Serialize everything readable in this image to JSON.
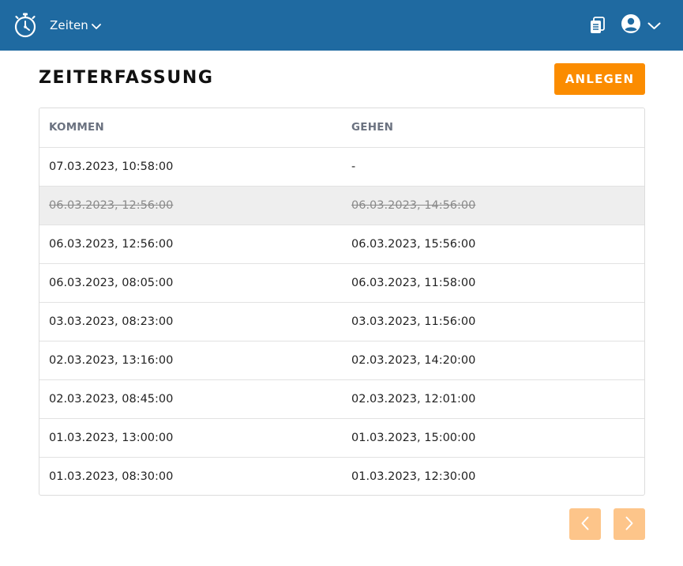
{
  "nav": {
    "menu_label": "Zeiten",
    "menu_icon": "chevron-down-icon",
    "logo_icon": "stopwatch-icon",
    "docs_icon": "documents-icon",
    "user_icon": "user-circle-icon",
    "bar_color": "#1f6aa1"
  },
  "page": {
    "title": "ZEITERFASSUNG",
    "create_label": "ANLEGEN",
    "accent_color": "#fb8c00"
  },
  "table": {
    "columns": [
      "KOMMEN",
      "GEHEN"
    ],
    "rows": [
      {
        "kommen": "07.03.2023, 10:58:00",
        "gehen": "-",
        "deleted": false
      },
      {
        "kommen": "06.03.2023, 12:56:00",
        "gehen": "06.03.2023, 14:56:00",
        "deleted": true
      },
      {
        "kommen": "06.03.2023, 12:56:00",
        "gehen": "06.03.2023, 15:56:00",
        "deleted": false
      },
      {
        "kommen": "06.03.2023, 08:05:00",
        "gehen": "06.03.2023, 11:58:00",
        "deleted": false
      },
      {
        "kommen": "03.03.2023, 08:23:00",
        "gehen": "03.03.2023, 11:56:00",
        "deleted": false
      },
      {
        "kommen": "02.03.2023, 13:16:00",
        "gehen": "02.03.2023, 14:20:00",
        "deleted": false
      },
      {
        "kommen": "02.03.2023, 08:45:00",
        "gehen": "02.03.2023, 12:01:00",
        "deleted": false
      },
      {
        "kommen": "01.03.2023, 13:00:00",
        "gehen": "01.03.2023, 15:00:00",
        "deleted": false
      },
      {
        "kommen": "01.03.2023, 08:30:00",
        "gehen": "01.03.2023, 12:30:00",
        "deleted": false
      }
    ]
  },
  "pagination": {
    "prev_icon": "chevron-left-icon",
    "next_icon": "chevron-right-icon",
    "button_color": "#fdc58a"
  }
}
